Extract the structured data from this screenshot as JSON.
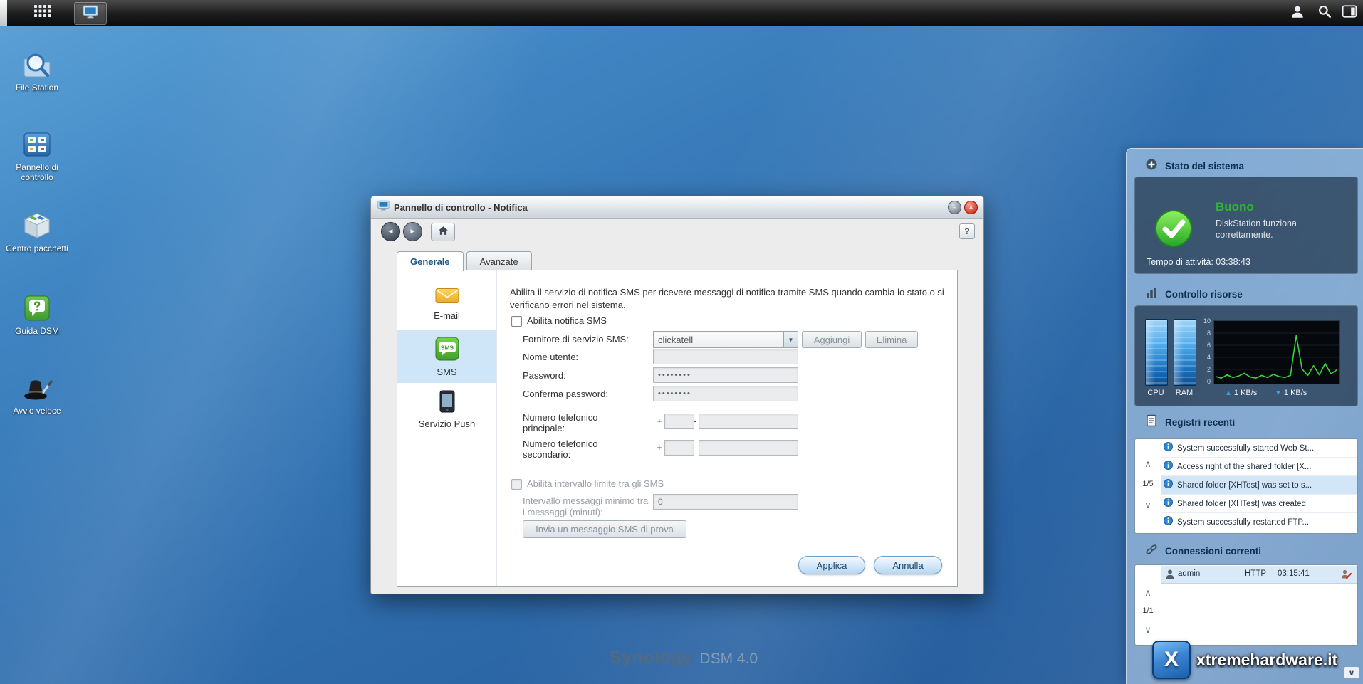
{
  "glyphs": {
    "chev_up": "∧",
    "chev_down": "∨",
    "arrow_up": "▲",
    "arrow_down": "▼",
    "help": "?",
    "minimize": "–",
    "close": "×",
    "back": "◄",
    "forward": "►",
    "dash": "-"
  },
  "desktop": {
    "icons": [
      {
        "label": "File Station"
      },
      {
        "label": "Pannello di controllo"
      },
      {
        "label": "Centro pacchetti"
      },
      {
        "label": "Guida DSM"
      },
      {
        "label": "Avvio veloce"
      }
    ],
    "brand": "Synology",
    "version": "DSM 4.0"
  },
  "window": {
    "title": "Pannello di controllo - Notifica",
    "sms_badge": "SMS",
    "tabs": [
      {
        "label": "Generale"
      },
      {
        "label": "Avanzate"
      }
    ],
    "nav": [
      {
        "label": "E-mail"
      },
      {
        "label": "SMS"
      },
      {
        "label": "Servizio Push"
      }
    ],
    "form": {
      "description": "Abilita il servizio di notifica SMS per ricevere messaggi di notifica tramite SMS quando cambia lo stato o si verificano errori nel sistema.",
      "enable_label": "Abilita notifica SMS",
      "provider_label": "Fornitore di servizio SMS:",
      "provider_value": "clickatell",
      "add_label": "Aggiungi",
      "delete_label": "Elimina",
      "username_label": "Nome utente:",
      "username_value": "",
      "password_label": "Password:",
      "password_value": "••••••••",
      "confirm_label": "Conferma password:",
      "confirm_value": "••••••••",
      "phone1_label": "Numero telefonico principale:",
      "phone2_label": "Numero telefonico secondario:",
      "phone_prefix": "+",
      "limit_label": "Abilita intervallo limite tra gli SMS",
      "interval_label": "Intervallo messaggi minimo tra i messaggi (minuti):",
      "interval_value": "0",
      "test_label": "Invia un messaggio SMS di prova",
      "apply_label": "Applica",
      "cancel_label": "Annulla"
    }
  },
  "sidebar": {
    "system_status": {
      "title": "Stato del sistema",
      "status": "Buono",
      "message": "DiskStation funziona correttamente.",
      "uptime": "Tempo di attività: 03:38:43"
    },
    "resources": {
      "title": "Controllo risorse",
      "cpu": "CPU",
      "ram": "RAM",
      "upload_rate": "1 KB/s",
      "download_rate": "1 KB/s",
      "chart": {
        "type": "line",
        "unit": "KB/s",
        "ylim": [
          0,
          10
        ],
        "y_ticks": [
          "10",
          "8",
          "6",
          "4",
          "2",
          "0"
        ],
        "points_kbs": [
          0.8,
          0.5,
          1.1,
          0.6,
          0.9,
          1.4,
          0.7,
          0.5,
          1.0,
          0.6,
          1.2,
          0.8,
          0.6,
          1.0,
          8.4,
          2.2,
          1.0,
          2.8,
          1.1,
          3.2,
          1.3,
          2.0
        ]
      }
    },
    "logs": {
      "title": "Registri recenti",
      "page": "1/5",
      "items": [
        "System successfully started Web St...",
        "Access right of the shared folder [X...",
        "Shared folder [XHTest] was set to s...",
        "Shared folder [XHTest] was created.",
        "System successfully restarted FTP..."
      ]
    },
    "connections": {
      "title": "Connessioni correnti",
      "page": "1/1",
      "rows": [
        {
          "user": "admin",
          "protocol": "HTTP",
          "time": "03:15:41"
        }
      ]
    }
  },
  "watermark": {
    "site": "xtremehardware.it"
  }
}
